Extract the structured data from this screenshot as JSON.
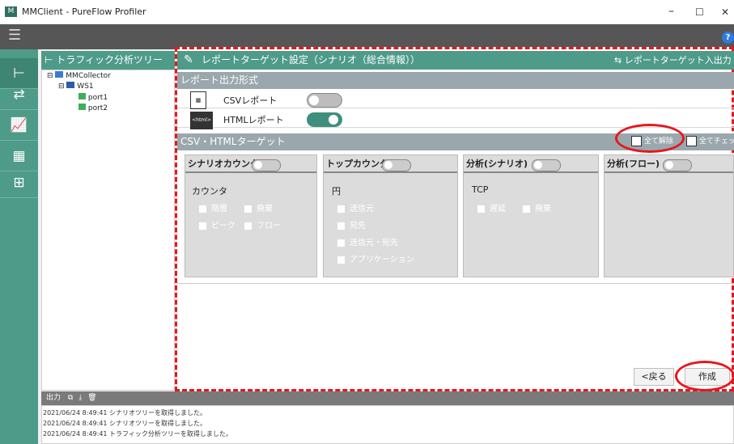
{
  "window": {
    "title": "MMClient - PureFlow Profiler",
    "minimize": "–",
    "maximize": "☐",
    "close": "✕"
  },
  "menu": {
    "hamburger": "☰",
    "help": "?"
  },
  "leftnav": {
    "icons": [
      "⊢",
      "⇄",
      "📈",
      "▦",
      "⊞"
    ]
  },
  "tree": {
    "header": "トラフィック分析ツリー",
    "items": [
      {
        "label": "MMCollector",
        "expander": "⊟"
      },
      {
        "label": "WS1",
        "expander": "⊟"
      },
      {
        "label": "port1"
      },
      {
        "label": "port2"
      }
    ]
  },
  "main": {
    "title": "レポートターゲット設定（シナリオ（総合情報））",
    "io_label": "レポートターゲット入出力",
    "format_section": "レポート出力形式",
    "csv_label": "CSVレポート",
    "html_label": "HTMLレポート",
    "csv_enabled": false,
    "html_enabled": true,
    "target_section": "CSV・HTMLターゲット",
    "clear_all": "全て解除",
    "check_all": "全てチェック",
    "boxes": [
      {
        "title": "シナリオカウンタ",
        "sub": "カウンタ",
        "items": [
          "階層",
          "廃棄",
          "ピーク",
          "フロー"
        ]
      },
      {
        "title": "トップカウンタ",
        "sub": "円",
        "items": [
          "送信元",
          "宛先",
          "送信元・宛先",
          "アプリケーション"
        ]
      },
      {
        "title": "分析(シナリオ)",
        "sub": "TCP",
        "items": [
          "遅延",
          "廃棄"
        ]
      },
      {
        "title": "分析(フロー)",
        "sub": "",
        "items": []
      }
    ],
    "back_button": "<戻る",
    "create_button": "作成"
  },
  "output": {
    "header": "出力",
    "logs": [
      "2021/06/24 8:49:41 シナリオツリーを取得しました。",
      "2021/06/24 8:49:41 シナリオツリーを取得しました。",
      "2021/06/24 8:49:41 トラフィック分析ツリーを取得しました。"
    ]
  },
  "colors": {
    "teal": "#4e9b89",
    "highlight_red": "#e8161d",
    "section_gray": "#9aa8ad"
  }
}
